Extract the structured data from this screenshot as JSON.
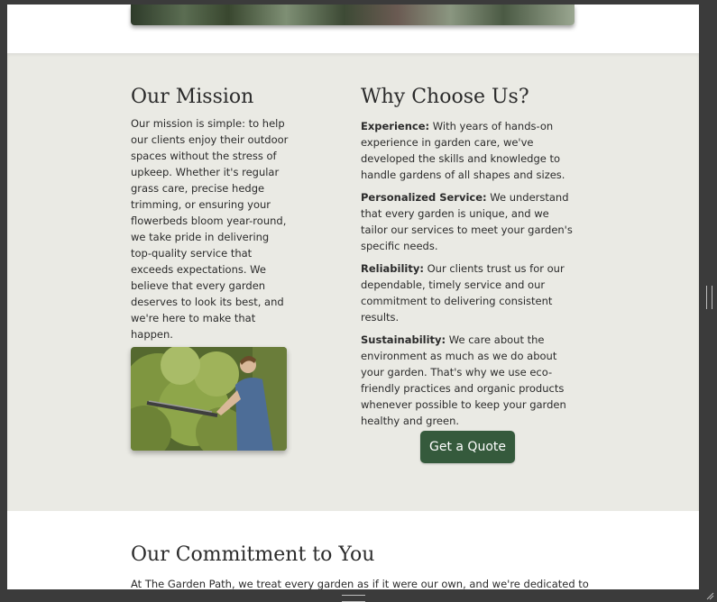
{
  "mission": {
    "heading": "Our Mission",
    "text": "Our mission is simple: to help our clients enjoy their outdoor spaces without the stress of upkeep. Whether it's regular grass care, precise hedge trimming, or ensuring your flowerbeds bloom year-round, we take pride in delivering top-quality service that exceeds expectations. We believe that every garden deserves to look its best, and we're here to make that happen."
  },
  "why": {
    "heading": "Why Choose Us?",
    "items": [
      {
        "title": "Experience:",
        "text": " With years of hands-on experience in garden care, we've developed the skills and knowledge to handle gardens of all shapes and sizes."
      },
      {
        "title": "Personalized Service:",
        "text": " We understand that every garden is unique, and we tailor our services to meet your garden's specific needs."
      },
      {
        "title": "Reliability:",
        "text": " Our clients trust us for our dependable, timely service and our commitment to delivering consistent results."
      },
      {
        "title": "Sustainability:",
        "text": " We care about the environment as much as we do about your garden. That's why we use eco-friendly practices and organic products whenever possible to keep your garden healthy and green."
      }
    ]
  },
  "cta": {
    "quote_label": "Get a Quote"
  },
  "commitment": {
    "heading": "Our Commitment to You",
    "text": "At The Garden Path, we treat every garden as if it were our own, and we're dedicated to"
  },
  "colors": {
    "button": "#355a3c",
    "section_bg": "#eaeae4"
  }
}
